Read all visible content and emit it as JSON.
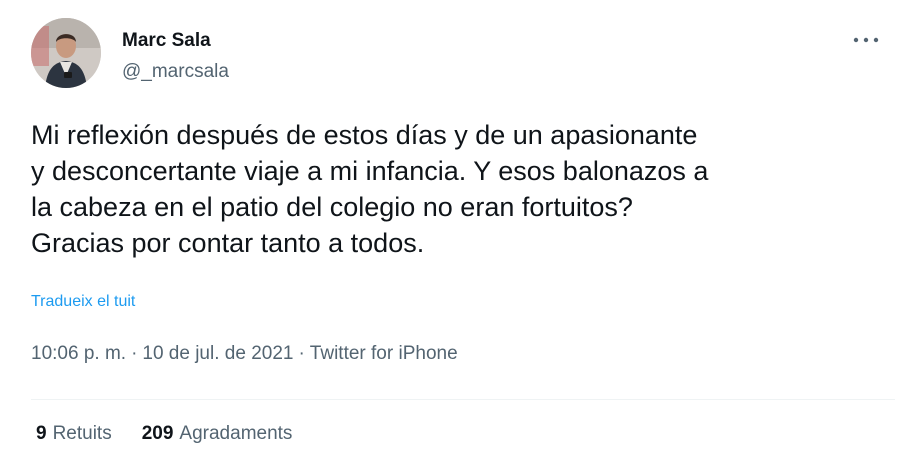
{
  "author": {
    "name": "Marc Sala",
    "handle": "@_marcsala",
    "avatar_icon": "profile-photo"
  },
  "more_icon": "more-horizontal-icon",
  "tweet": {
    "lines": [
      "Mi reflexión después de estos días y de un apasionante",
      "y desconcertante viaje a mi infancia. Y esos balonazos a",
      "la cabeza en el patio del colegio no eran fortuitos?",
      "Gracias por contar tanto a todos."
    ],
    "translate_label": "Tradueix el tuit",
    "time": "10:06 p. m.",
    "date": "10 de jul. de 2021",
    "source": "Twitter for iPhone",
    "separator": "·"
  },
  "stats": {
    "retweets_count": "9",
    "retweets_label": "Retuits",
    "likes_count": "209",
    "likes_label": "Agradaments"
  },
  "colors": {
    "text": "#0f1419",
    "secondary": "#536471",
    "link": "#1d9bf0",
    "divider": "#eff3f4"
  }
}
